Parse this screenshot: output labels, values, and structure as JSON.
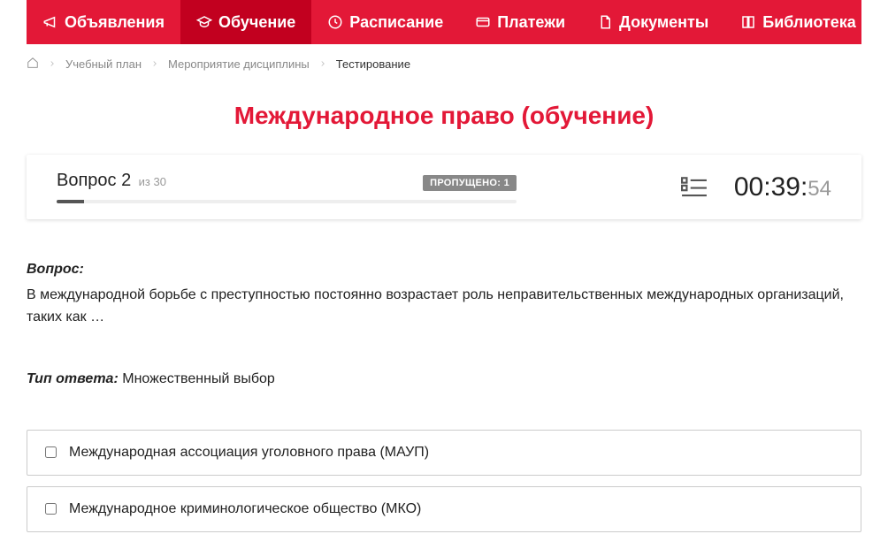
{
  "nav": {
    "items": [
      {
        "label": "Объявления"
      },
      {
        "label": "Обучение"
      },
      {
        "label": "Расписание"
      },
      {
        "label": "Платежи"
      },
      {
        "label": "Документы"
      },
      {
        "label": "Библиотека"
      }
    ]
  },
  "breadcrumb": {
    "items": [
      {
        "label": "Учебный план"
      },
      {
        "label": "Мероприятие дисциплины"
      }
    ],
    "current": "Тестирование"
  },
  "page": {
    "title": "Международное право (обучение)"
  },
  "status": {
    "question_label": "Вопрос 2",
    "of_label": "из 30",
    "skipped_label": "ПРОПУЩЕНО: 1",
    "timer_main": "00:39:",
    "timer_sec": "54"
  },
  "question": {
    "heading": "Вопрос:",
    "text": "В международной борьбе с преступностью постоянно возрастает роль неправительственных международных организаций, таких как …",
    "answer_type_label": "Тип ответа:",
    "answer_type_value": "Множественный выбор"
  },
  "options": [
    {
      "label": "Международная ассоциация уголовного права (МАУП)"
    },
    {
      "label": "Международное криминологическое общество (МКО)"
    }
  ]
}
